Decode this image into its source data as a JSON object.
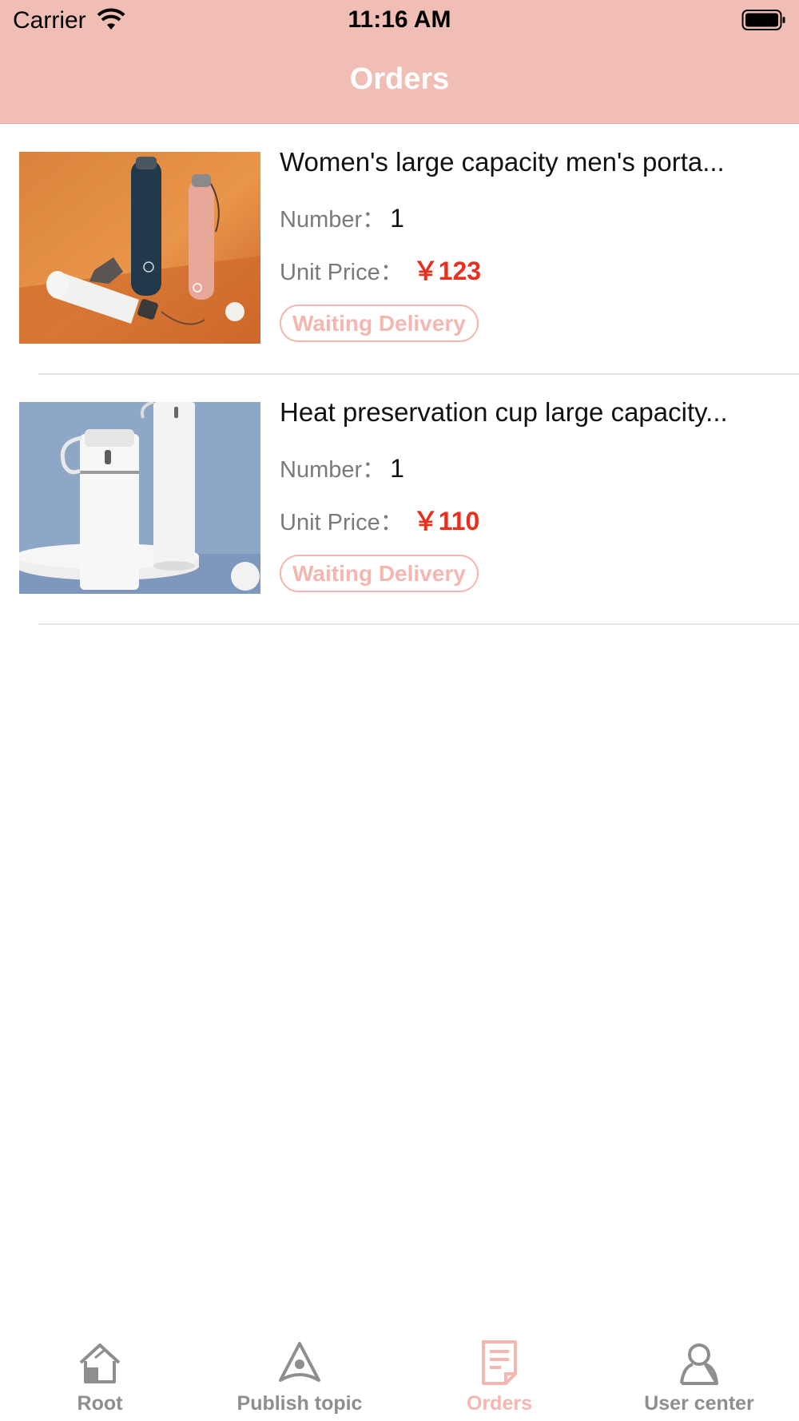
{
  "status_bar": {
    "carrier": "Carrier",
    "time": "11:16 AM"
  },
  "nav": {
    "title": "Orders"
  },
  "orders": [
    {
      "title": "Women's large capacity men's porta...",
      "qty_label": "Number：",
      "qty": "1",
      "price_label": "Unit Price：",
      "price": "￥123",
      "status": "Waiting Delivery"
    },
    {
      "title": "Heat preservation cup large capacity...",
      "qty_label": "Number：",
      "qty": "1",
      "price_label": "Unit Price：",
      "price": "￥110",
      "status": "Waiting Delivery"
    }
  ],
  "tabbar": {
    "items": [
      {
        "label": "Root",
        "icon": "home-icon",
        "active": false
      },
      {
        "label": "Publish topic",
        "icon": "publish-icon",
        "active": false
      },
      {
        "label": "Orders",
        "icon": "orders-icon",
        "active": true
      },
      {
        "label": "User center",
        "icon": "user-icon",
        "active": false
      }
    ]
  },
  "colors": {
    "header": "#f1beb6",
    "accent": "#f4b6b0",
    "price": "#e8301f",
    "inactive": "#8e8e8e"
  }
}
